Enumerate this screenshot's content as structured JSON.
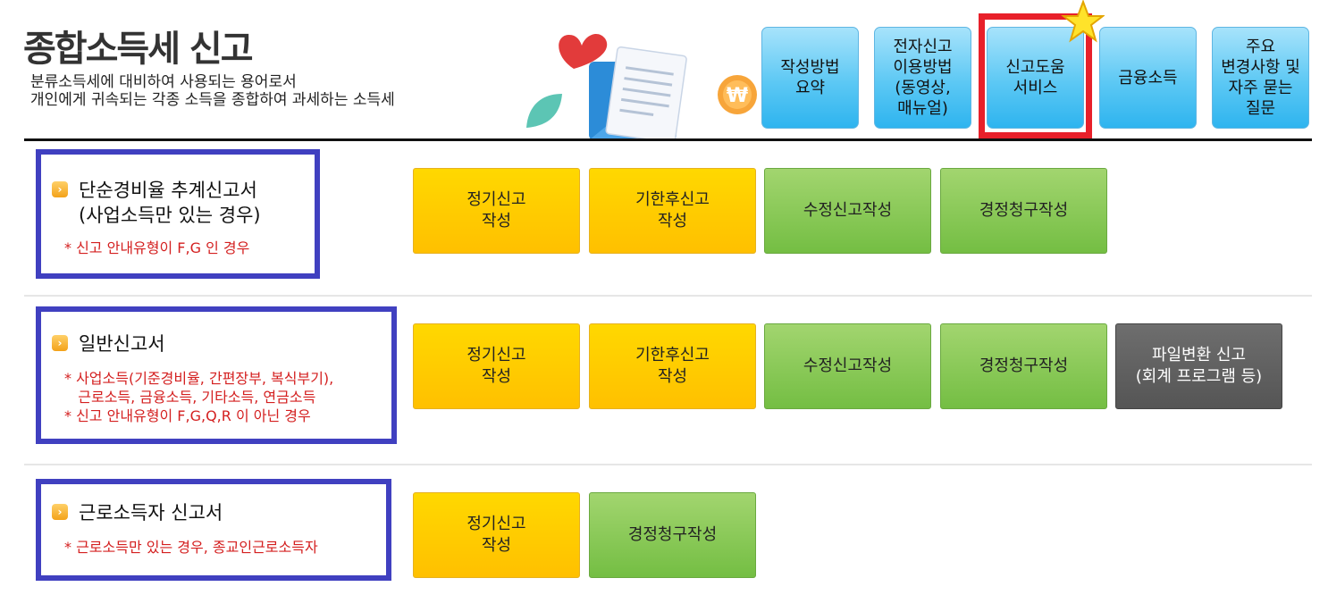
{
  "header": {
    "title": "종합소득세 신고",
    "subtitle_line1": "분류소득세에 대비하여 사용되는 용어로서",
    "subtitle_line2": "개인에게 귀속되는 각종 소득을 종합하여 과세하는 소득세"
  },
  "top_buttons": [
    {
      "label": "작성방법\n요약"
    },
    {
      "label": "전자신고\n이용방법\n(동영상,\n매뉴얼)"
    },
    {
      "label": "신고도움\n서비스"
    },
    {
      "label": "금융소득"
    },
    {
      "label": "주요\n변경사항 및\n자주 묻는\n질문"
    }
  ],
  "sections": [
    {
      "title": "단순경비율 추계신고서\n(사업소득만 있는 경우)",
      "note": "* 신고 안내유형이 F,G 인 경우",
      "buttons": [
        "정기신고\n작성",
        "기한후신고\n작성",
        "수정신고작성",
        "경정청구작성"
      ]
    },
    {
      "title": "일반신고서",
      "note": "* 사업소득(기준경비율, 간편장부, 복식부기),\n   근로소득, 금융소득, 기타소득, 연금소득\n* 신고 안내유형이 F,G,Q,R 이 아닌 경우",
      "buttons": [
        "정기신고\n작성",
        "기한후신고\n작성",
        "수정신고작성",
        "경정청구작성",
        "파일변환 신고\n(회계 프로그램 등)"
      ]
    },
    {
      "title": "근로소득자 신고서",
      "note": "* 근로소득만 있는 경우, 종교인근로소득자",
      "buttons": [
        "정기신고\n작성",
        "경정청구작성"
      ]
    }
  ],
  "illustration": {
    "currency_symbol": "₩"
  },
  "colors": {
    "highlight_border": "#e8202a",
    "section_border": "#4040c0",
    "yellow_button": "#ffcc00",
    "green_button": "#8cc85a",
    "gray_button": "#5f5f5f",
    "top_button": "#4cc2f2",
    "note_text": "#d42020"
  }
}
